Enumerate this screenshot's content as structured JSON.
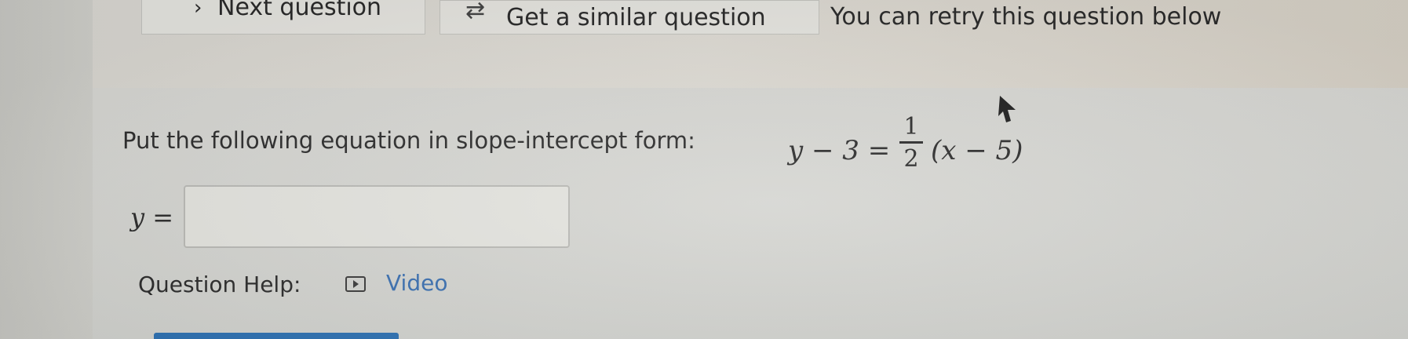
{
  "toolbar": {
    "next_label": "Next question",
    "next_icon": "chevron-right-icon",
    "similar_label": "Get a similar question",
    "similar_icon": "retry-arrows-icon",
    "retry_message": "You can retry this question below"
  },
  "question": {
    "prompt": "Put the following equation in slope-intercept form:",
    "equation": {
      "lhs": "y − 3 =",
      "fraction_numerator": "1",
      "fraction_denominator": "2",
      "rhs": "(x − 5)"
    },
    "answer_label": "y =",
    "answer_value": ""
  },
  "help": {
    "label": "Question Help:",
    "video_icon": "video-play-icon",
    "video_label": "Video"
  },
  "colors": {
    "link": "#3a6fb0",
    "submit_button": "#2f72b3"
  }
}
